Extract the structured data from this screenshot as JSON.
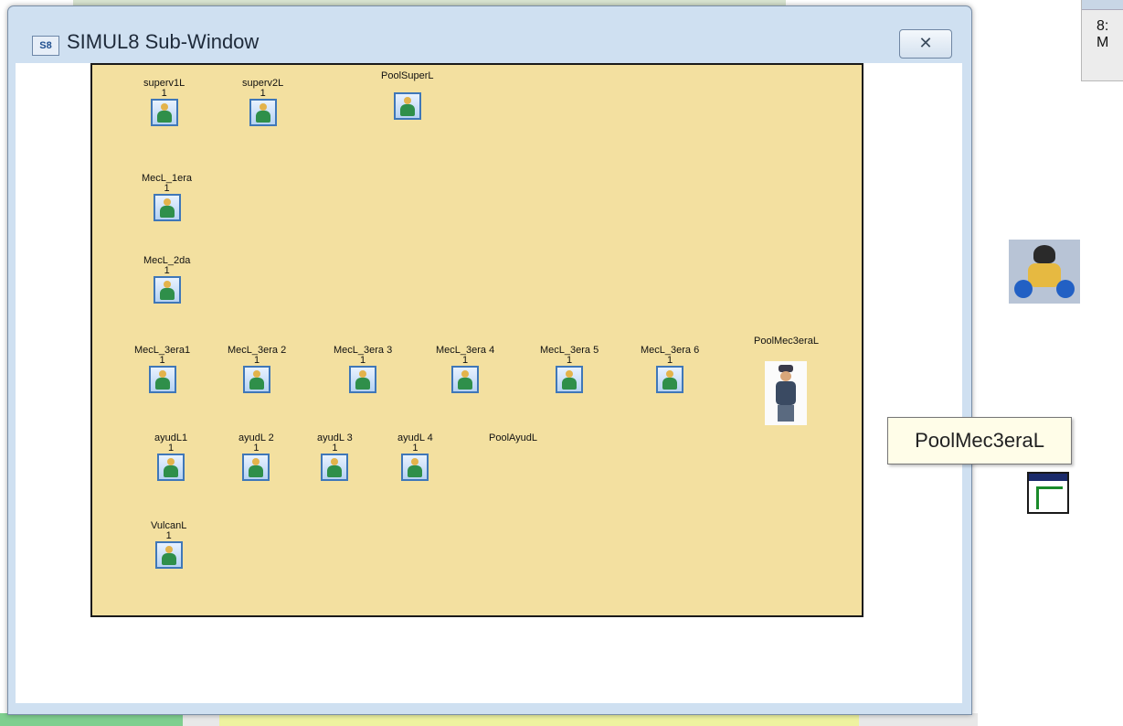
{
  "window": {
    "icon_text": "S8",
    "title": "SIMUL8 Sub-Window",
    "close_glyph": "✕"
  },
  "corner": {
    "line1": "8:",
    "line2": "M"
  },
  "canvas": {
    "objects": [
      {
        "id": "superv1L",
        "label": "superv1L",
        "count": "1",
        "icon": "person-icon"
      },
      {
        "id": "superv2L",
        "label": "superv2L",
        "count": "1",
        "icon": "person-icon"
      },
      {
        "id": "PoolSuperL",
        "label": "PoolSuperL",
        "count": "",
        "icon": "person-icon"
      },
      {
        "id": "MecL_1era",
        "label": "MecL_1era",
        "count": "1",
        "icon": "person-icon"
      },
      {
        "id": "MecL_2da",
        "label": "MecL_2da",
        "count": "1",
        "icon": "person-icon"
      },
      {
        "id": "MecL_3era1",
        "label": "MecL_3era1",
        "count": "1",
        "icon": "person-icon"
      },
      {
        "id": "MecL_3era2",
        "label": "MecL_3era 2",
        "count": "1",
        "icon": "person-icon"
      },
      {
        "id": "MecL_3era3",
        "label": "MecL_3era 3",
        "count": "1",
        "icon": "person-icon"
      },
      {
        "id": "MecL_3era4",
        "label": "MecL_3era 4",
        "count": "1",
        "icon": "person-icon"
      },
      {
        "id": "MecL_3era5",
        "label": "MecL_3era 5",
        "count": "1",
        "icon": "person-icon"
      },
      {
        "id": "MecL_3era6",
        "label": "MecL_3era 6",
        "count": "1",
        "icon": "person-icon"
      },
      {
        "id": "PoolMec3eraL",
        "label": "PoolMec3eraL",
        "count": "",
        "icon": "mechanic-icon"
      },
      {
        "id": "ayudL1",
        "label": "ayudL1",
        "count": "1",
        "icon": "person-icon"
      },
      {
        "id": "ayudL2",
        "label": "ayudL 2",
        "count": "1",
        "icon": "person-icon"
      },
      {
        "id": "ayudL3",
        "label": "ayudL 3",
        "count": "1",
        "icon": "person-icon"
      },
      {
        "id": "ayudL4",
        "label": "ayudL 4",
        "count": "1",
        "icon": "person-icon"
      },
      {
        "id": "PoolAyudL",
        "label": "PoolAyudL",
        "count": "",
        "icon": "none"
      },
      {
        "id": "VulcanL",
        "label": "VulcanL",
        "count": "1",
        "icon": "person-icon"
      }
    ]
  },
  "tooltip": {
    "text": "PoolMec3eraL"
  },
  "colors": {
    "canvas_bg": "#f3e0a0",
    "window_frame": "#cfe0f1",
    "icon_border": "#3f77b8"
  }
}
